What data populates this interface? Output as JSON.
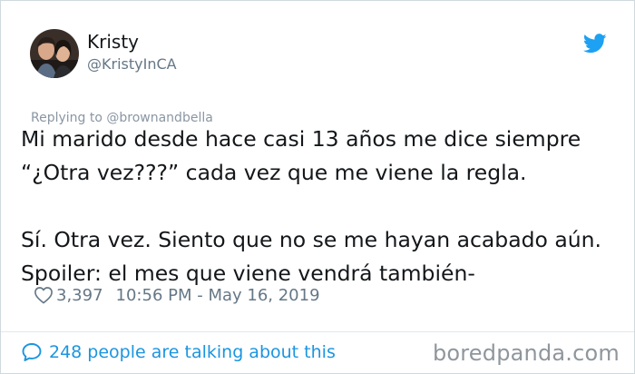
{
  "author": {
    "name": "Kristy",
    "handle": "@KristyInCA"
  },
  "reply_context": "Replying to @brownandbella",
  "tweet": {
    "lines": [
      "Mi marido desde hace casi 13 años me dice siempre",
      "“¿Otra vez???” cada vez que me viene la regla.",
      "",
      "Sí. Otra vez. Siento que no se me hayan acabado aún.",
      "Spoiler: el mes que viene vendrá también-"
    ]
  },
  "meta": {
    "likes": "3,397",
    "timestamp": "10:56 PM - May 16, 2019"
  },
  "talking": "248 people are talking about this",
  "watermark": "boredpanda.com",
  "colors": {
    "twitter_blue": "#1da1f2",
    "link_blue": "#1b95e0",
    "secondary_text": "#657786",
    "primary_text": "#14171a"
  },
  "icons": [
    "twitter-bird-icon",
    "heart-icon",
    "comment-bubble-icon"
  ]
}
